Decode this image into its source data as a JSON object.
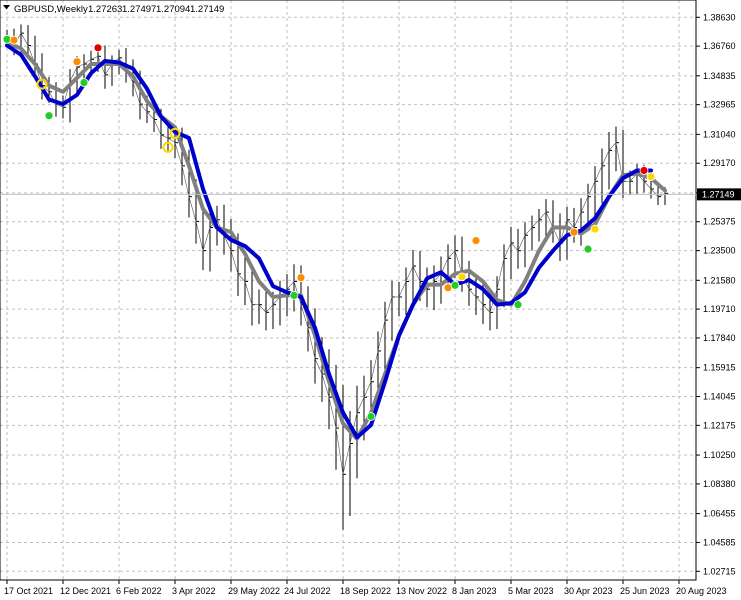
{
  "header": {
    "symbol_label": "GBPUSD,Weekly",
    "ohlc": [
      "1.27263",
      "1.27497",
      "1.27094",
      "1.27149"
    ]
  },
  "current_price": {
    "label": "1.27149",
    "value": 1.27149
  },
  "colors": {
    "background": "#ffffff",
    "grid": "#c0c0c0",
    "price_bars": "#000000",
    "fast_line": "#808080",
    "slow_line": "#0000cc",
    "dot_red": "#e00000",
    "dot_orange": "#ff8c00",
    "dot_green": "#22cc22",
    "dot_yellow": "#ffd700",
    "price_label_bg": "#000000"
  },
  "chart_data": {
    "type": "line",
    "title": "GBPUSD,Weekly",
    "ylim": [
      1.0215,
      1.3975
    ],
    "grid": true,
    "yticks": [
      "1.38630",
      "1.36760",
      "1.34835",
      "1.32965",
      "1.31040",
      "1.29170",
      "1.27245",
      "1.25375",
      "1.23500",
      "1.21580",
      "1.19710",
      "1.17840",
      "1.15915",
      "1.14045",
      "1.12175",
      "1.10250",
      "1.08380",
      "1.06455",
      "1.04585",
      "1.02715"
    ],
    "xticks": [
      {
        "label": "17 Oct 2021",
        "bar": 0
      },
      {
        "label": "12 Dec 2021",
        "bar": 8
      },
      {
        "label": "6 Feb 2022",
        "bar": 16
      },
      {
        "label": "3 Apr 2022",
        "bar": 24
      },
      {
        "label": "29 May 2022",
        "bar": 32
      },
      {
        "label": "24 Jul 2022",
        "bar": 40
      },
      {
        "label": "18 Sep 2022",
        "bar": 48
      },
      {
        "label": "13 Nov 2022",
        "bar": 56
      },
      {
        "label": "8 Jan 2023",
        "bar": 64
      },
      {
        "label": "5 Mar 2023",
        "bar": 72
      },
      {
        "label": "30 Apr 2023",
        "bar": 80
      },
      {
        "label": "25 Jun 2023",
        "bar": 88
      },
      {
        "label": "20 Aug 2023",
        "bar": 96
      }
    ],
    "close": [
      1.374,
      1.368,
      1.376,
      1.368,
      1.356,
      1.342,
      1.338,
      1.33,
      1.328,
      1.345,
      1.354,
      1.356,
      1.359,
      1.361,
      1.349,
      1.356,
      1.36,
      1.352,
      1.344,
      1.33,
      1.325,
      1.32,
      1.31,
      1.308,
      1.305,
      1.29,
      1.27,
      1.254,
      1.235,
      1.25,
      1.255,
      1.245,
      1.235,
      1.22,
      1.215,
      1.2,
      1.2,
      1.195,
      1.2,
      1.205,
      1.21,
      1.215,
      1.2,
      1.185,
      1.165,
      1.155,
      1.14,
      1.12,
      1.09,
      1.11,
      1.13,
      1.14,
      1.15,
      1.17,
      1.19,
      1.205,
      1.205,
      1.215,
      1.225,
      1.215,
      1.21,
      1.215,
      1.22,
      1.23,
      1.235,
      1.22,
      1.21,
      1.205,
      1.2,
      1.195,
      1.21,
      1.23,
      1.24,
      1.235,
      1.245,
      1.25,
      1.255,
      1.26,
      1.25,
      1.24,
      1.255,
      1.25,
      1.26,
      1.27,
      1.28,
      1.29,
      1.3,
      1.305,
      1.28,
      1.28,
      1.285,
      1.28,
      1.275,
      1.27,
      1.272
    ],
    "range": [
      0.012,
      0.014,
      0.016,
      0.015,
      0.018,
      0.02,
      0.016,
      0.018,
      0.016,
      0.022,
      0.02,
      0.018,
      0.016,
      0.018,
      0.02,
      0.016,
      0.015,
      0.018,
      0.02,
      0.022,
      0.016,
      0.018,
      0.02,
      0.018,
      0.022,
      0.028,
      0.03,
      0.032,
      0.028,
      0.03,
      0.026,
      0.028,
      0.03,
      0.032,
      0.034,
      0.03,
      0.028,
      0.026,
      0.024,
      0.03,
      0.028,
      0.032,
      0.03,
      0.034,
      0.036,
      0.04,
      0.046,
      0.06,
      0.08,
      0.06,
      0.05,
      0.04,
      0.04,
      0.036,
      0.034,
      0.03,
      0.028,
      0.026,
      0.03,
      0.028,
      0.026,
      0.03,
      0.032,
      0.026,
      0.028,
      0.026,
      0.024,
      0.026,
      0.028,
      0.026,
      0.024,
      0.026,
      0.03,
      0.026,
      0.024,
      0.022,
      0.02,
      0.024,
      0.022,
      0.026,
      0.024,
      0.022,
      0.026,
      0.024,
      0.028,
      0.032,
      0.034,
      0.03,
      0.024,
      0.02,
      0.018,
      0.016,
      0.014,
      0.012,
      0.012
    ],
    "series": [
      {
        "name": "",
        "color": "#808080",
        "points": [
          [
            0,
            1.37
          ],
          [
            2,
            1.366
          ],
          [
            4,
            1.356
          ],
          [
            6,
            1.342
          ],
          [
            8,
            1.338
          ],
          [
            10,
            1.347
          ],
          [
            12,
            1.356
          ],
          [
            14,
            1.356
          ],
          [
            16,
            1.356
          ],
          [
            18,
            1.348
          ],
          [
            20,
            1.332
          ],
          [
            22,
            1.322
          ],
          [
            24,
            1.315
          ],
          [
            26,
            1.29
          ],
          [
            28,
            1.262
          ],
          [
            30,
            1.25
          ],
          [
            32,
            1.247
          ],
          [
            34,
            1.233
          ],
          [
            36,
            1.215
          ],
          [
            38,
            1.205
          ],
          [
            40,
            1.206
          ],
          [
            42,
            1.206
          ],
          [
            44,
            1.18
          ],
          [
            46,
            1.15
          ],
          [
            48,
            1.123
          ],
          [
            50,
            1.113
          ],
          [
            52,
            1.13
          ],
          [
            54,
            1.155
          ],
          [
            56,
            1.18
          ],
          [
            58,
            1.2
          ],
          [
            60,
            1.213
          ],
          [
            62,
            1.213
          ],
          [
            64,
            1.22
          ],
          [
            66,
            1.222
          ],
          [
            68,
            1.215
          ],
          [
            70,
            1.203
          ],
          [
            72,
            1.2
          ],
          [
            74,
            1.215
          ],
          [
            76,
            1.235
          ],
          [
            78,
            1.25
          ],
          [
            80,
            1.25
          ],
          [
            82,
            1.246
          ],
          [
            84,
            1.252
          ],
          [
            86,
            1.27
          ],
          [
            88,
            1.284
          ],
          [
            90,
            1.285
          ],
          [
            92,
            1.282
          ],
          [
            94,
            1.274
          ]
        ]
      },
      {
        "name": "",
        "color": "#0000cc",
        "points": [
          [
            0,
            1.368
          ],
          [
            2,
            1.362
          ],
          [
            4,
            1.348
          ],
          [
            6,
            1.333
          ],
          [
            8,
            1.33
          ],
          [
            10,
            1.336
          ],
          [
            12,
            1.35
          ],
          [
            14,
            1.358
          ],
          [
            16,
            1.357
          ],
          [
            18,
            1.353
          ],
          [
            20,
            1.34
          ],
          [
            22,
            1.322
          ],
          [
            24,
            1.312
          ],
          [
            26,
            1.308
          ],
          [
            28,
            1.275
          ],
          [
            30,
            1.25
          ],
          [
            32,
            1.242
          ],
          [
            34,
            1.238
          ],
          [
            36,
            1.23
          ],
          [
            38,
            1.212
          ],
          [
            40,
            1.208
          ],
          [
            42,
            1.205
          ],
          [
            44,
            1.185
          ],
          [
            46,
            1.155
          ],
          [
            48,
            1.13
          ],
          [
            50,
            1.114
          ],
          [
            52,
            1.122
          ],
          [
            54,
            1.15
          ],
          [
            56,
            1.18
          ],
          [
            58,
            1.2
          ],
          [
            60,
            1.217
          ],
          [
            62,
            1.221
          ],
          [
            64,
            1.213
          ],
          [
            66,
            1.216
          ],
          [
            68,
            1.21
          ],
          [
            70,
            1.2
          ],
          [
            72,
            1.201
          ],
          [
            74,
            1.208
          ],
          [
            76,
            1.224
          ],
          [
            78,
            1.235
          ],
          [
            80,
            1.245
          ],
          [
            82,
            1.248
          ],
          [
            84,
            1.256
          ],
          [
            86,
            1.27
          ],
          [
            88,
            1.282
          ],
          [
            90,
            1.287
          ],
          [
            92,
            1.287
          ]
        ]
      }
    ],
    "markers": [
      {
        "bar": 0,
        "value": 1.372,
        "color": "#22cc22"
      },
      {
        "bar": 1,
        "value": 1.3715,
        "color": "#ff8c00"
      },
      {
        "bar": 5,
        "value": 1.343,
        "color": "#ffd700",
        "hollow": true
      },
      {
        "bar": 6,
        "value": 1.3225,
        "color": "#22cc22"
      },
      {
        "bar": 10,
        "value": 1.3575,
        "color": "#ff8c00"
      },
      {
        "bar": 11,
        "value": 1.344,
        "color": "#22cc22"
      },
      {
        "bar": 13,
        "value": 1.3665,
        "color": "#e00000"
      },
      {
        "bar": 23,
        "value": 1.302,
        "color": "#ffd700",
        "hollow": true
      },
      {
        "bar": 24,
        "value": 1.311,
        "color": "#ffd700",
        "hollow": true
      },
      {
        "bar": 41,
        "value": 1.206,
        "color": "#22cc22"
      },
      {
        "bar": 42,
        "value": 1.2175,
        "color": "#ff8c00"
      },
      {
        "bar": 52,
        "value": 1.1275,
        "color": "#22cc22"
      },
      {
        "bar": 63,
        "value": 1.211,
        "color": "#ff8c00"
      },
      {
        "bar": 64,
        "value": 1.2125,
        "color": "#22cc22"
      },
      {
        "bar": 65,
        "value": 1.218,
        "color": "#ffd700"
      },
      {
        "bar": 67,
        "value": 1.2415,
        "color": "#ff8c00"
      },
      {
        "bar": 73,
        "value": 1.2,
        "color": "#22cc22"
      },
      {
        "bar": 81,
        "value": 1.247,
        "color": "#ff8c00"
      },
      {
        "bar": 83,
        "value": 1.236,
        "color": "#22cc22"
      },
      {
        "bar": 84,
        "value": 1.249,
        "color": "#ffd700"
      },
      {
        "bar": 91,
        "value": 1.287,
        "color": "#e00000"
      },
      {
        "bar": 92,
        "value": 1.283,
        "color": "#ffd700"
      }
    ]
  }
}
